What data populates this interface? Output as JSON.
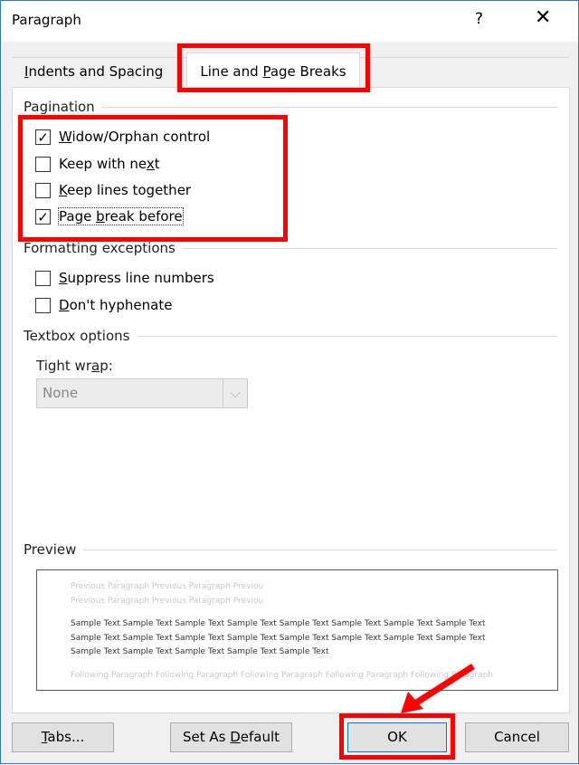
{
  "window": {
    "title": "Paragraph",
    "help": "?",
    "close": "✕"
  },
  "tabs": [
    {
      "label": "Indents and Spacing",
      "active": false
    },
    {
      "label": "Line and Page Breaks",
      "active": true
    }
  ],
  "pagination": {
    "heading": "Pagination",
    "items": [
      {
        "label": "Widow/Orphan control",
        "checked": true
      },
      {
        "label": "Keep with next",
        "checked": false
      },
      {
        "label": "Keep lines together",
        "checked": false
      },
      {
        "label": "Page break before",
        "checked": true
      }
    ]
  },
  "formatting": {
    "heading": "Formatting exceptions",
    "items": [
      {
        "label": "Suppress line numbers",
        "checked": false
      },
      {
        "label": "Don't hyphenate",
        "checked": false
      }
    ]
  },
  "textbox": {
    "heading": "Textbox options",
    "tight_wrap_label": "Tight wrap:",
    "tight_wrap_value": "None"
  },
  "preview": {
    "heading": "Preview",
    "lines": [
      "Previous Paragraph Previous Paragraph Previou",
      "Previous Paragraph Previous Paragraph Previou",
      "Sample Text Sample Text Sample Text Sample Text Sample Text Sample Text Sample Text Sample Text",
      "Sample Text Sample Text Sample Text Sample Text Sample Text Sample Text Sample Text Sample Text",
      "Sample Text Sample Text Sample Text Sample Text Sample Text",
      "Following Paragraph Following Paragraph Following Paragraph Following Paragraph Following Paragraph"
    ]
  },
  "buttons": {
    "tabs": "Tabs...",
    "default": "Set As Default",
    "ok": "OK",
    "cancel": "Cancel"
  },
  "colors": {
    "highlight": "#ff0000",
    "accent": "#2b79d0"
  }
}
